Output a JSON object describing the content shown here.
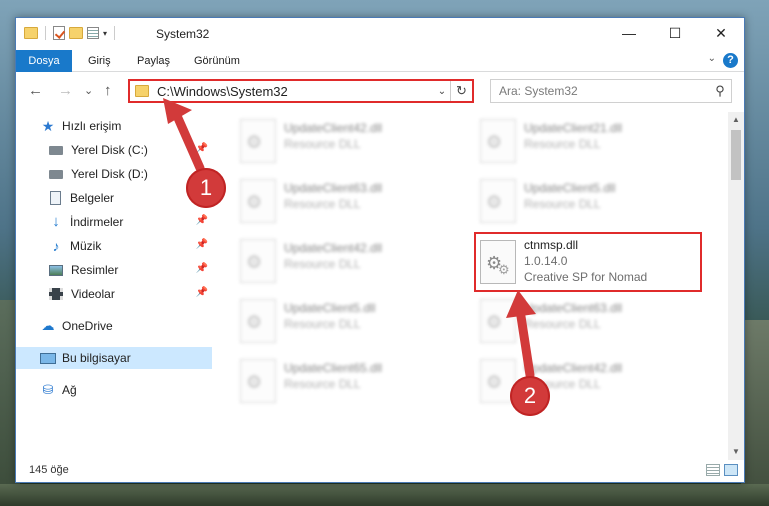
{
  "window": {
    "title": "System32",
    "minimize_glyph": "—",
    "maximize_glyph": "☐",
    "close_glyph": "✕"
  },
  "ribbon": {
    "tabs": [
      "Dosya",
      "Giriş",
      "Paylaş",
      "Görünüm"
    ],
    "help_glyph": "?",
    "collapse_glyph": "⌄"
  },
  "nav": {
    "back_glyph": "←",
    "forward_glyph": "→",
    "recent_glyph": "⌄",
    "up_glyph": "↑",
    "address": "C:\\Windows\\System32",
    "address_dropdown_glyph": "⌄",
    "refresh_glyph": "↻",
    "search_placeholder": "Ara: System32",
    "search_glyph": "⚲"
  },
  "sidebar": {
    "items": [
      {
        "label": "Hızlı erişim",
        "icon": "star-icon",
        "glyph": "★"
      },
      {
        "label": "Yerel Disk (C:)",
        "icon": "disk-icon"
      },
      {
        "label": "Yerel Disk (D:)",
        "icon": "disk-icon"
      },
      {
        "label": "Belgeler",
        "icon": "document-icon"
      },
      {
        "label": "İndirmeler",
        "icon": "download-icon",
        "glyph": "↓"
      },
      {
        "label": "Müzik",
        "icon": "music-icon",
        "glyph": "♪"
      },
      {
        "label": "Resimler",
        "icon": "pictures-icon"
      },
      {
        "label": "Videolar",
        "icon": "videos-icon"
      },
      {
        "label": "OneDrive",
        "icon": "cloud-icon",
        "glyph": "☁"
      },
      {
        "label": "Bu bilgisayar",
        "icon": "computer-icon"
      },
      {
        "label": "Ağ",
        "icon": "network-icon",
        "glyph": "⛁"
      }
    ],
    "pin_glyph": "📌"
  },
  "files": {
    "items": [
      {
        "name": "UpdateClient42.dll",
        "sub": "Resource DLL"
      },
      {
        "name": "UpdateClient21.dll",
        "sub": "Resource DLL"
      },
      {
        "name": "UpdateClient63.dll",
        "sub": "Resource DLL"
      },
      {
        "name": "UpdateClient5.dll",
        "sub": "Resource DLL"
      },
      {
        "name": "UpdateClient42.dll",
        "sub": "Resource DLL"
      },
      {
        "name": "UpdateClient5.dll",
        "sub": "Resource DLL"
      },
      {
        "name": "UpdateClient63.dll",
        "sub": "Resource DLL"
      },
      {
        "name": "UpdateClient65.dll",
        "sub": "Resource DLL"
      },
      {
        "name": "UpdateClient42.dll",
        "sub": "Resource DLL"
      }
    ],
    "highlighted": {
      "name": "ctnmsp.dll",
      "version": "1.0.14.0",
      "company": "Creative SP for Nomad"
    },
    "gear_glyph": "⚙"
  },
  "status": {
    "count": "145 öğe"
  },
  "callouts": [
    "1",
    "2"
  ],
  "colors": {
    "accent": "#1979ca",
    "highlight_red": "#e02b2b",
    "selected_bg": "#cce8ff"
  }
}
